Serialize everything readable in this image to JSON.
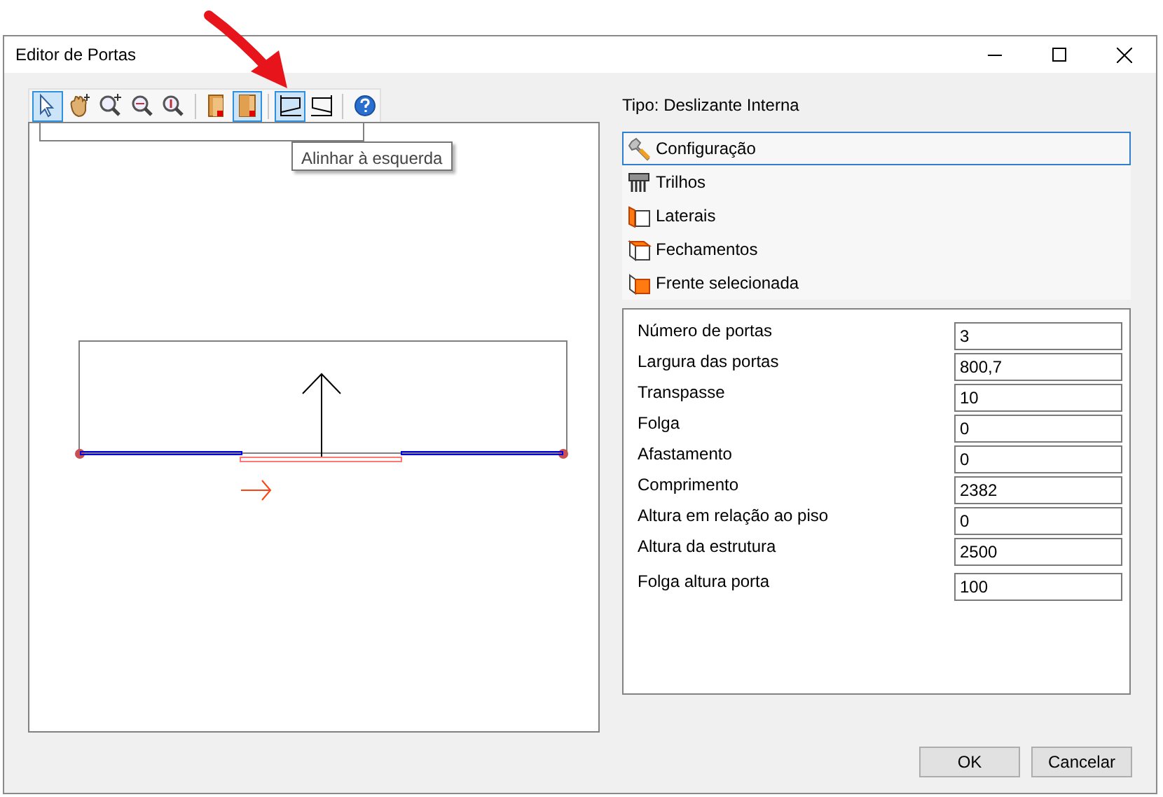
{
  "window": {
    "title": "Editor de Portas"
  },
  "toolbar": [
    [
      {
        "kind": "pointer",
        "selected": true
      },
      {
        "kind": "pan",
        "selected": false
      },
      {
        "kind": "zoom-in",
        "selected": false
      },
      {
        "kind": "zoom-window",
        "selected": false
      },
      {
        "kind": "zoom-extent",
        "selected": false
      }
    ],
    [
      {
        "kind": "door-left",
        "selected": false
      },
      {
        "kind": "door-right",
        "selected": true
      }
    ],
    [
      {
        "kind": "align-left",
        "selected": true
      },
      {
        "kind": "align-right",
        "selected": false
      }
    ],
    [
      {
        "kind": "help",
        "selected": false
      }
    ]
  ],
  "tooltip": "Alinhar à esquerda",
  "type_label": "Tipo: Deslizante Interna",
  "sections": [
    {
      "kind": "wrench",
      "label": "Configuração",
      "selected": true
    },
    {
      "kind": "rails",
      "label": "Trilhos",
      "selected": false
    },
    {
      "kind": "sides",
      "label": "Laterais",
      "selected": false
    },
    {
      "kind": "closures",
      "label": "Fechamentos",
      "selected": false
    },
    {
      "kind": "front",
      "label": "Frente selecionada",
      "selected": false
    }
  ],
  "properties": [
    {
      "label": "Número de portas",
      "value": "3"
    },
    {
      "label": "Largura das portas",
      "value": "800,7"
    },
    {
      "label": "Transpasse",
      "value": "10"
    },
    {
      "label": "Folga",
      "value": "0"
    },
    {
      "label": "Afastamento",
      "value": "0"
    },
    {
      "label": "Comprimento",
      "value": "2382"
    },
    {
      "label": "Altura em relação ao piso",
      "value": "0"
    },
    {
      "label": "Altura da estrutura",
      "value": "2500"
    },
    {
      "label": "Folga altura porta",
      "value": "100"
    }
  ],
  "buttons": [
    "OK",
    "Cancelar"
  ]
}
